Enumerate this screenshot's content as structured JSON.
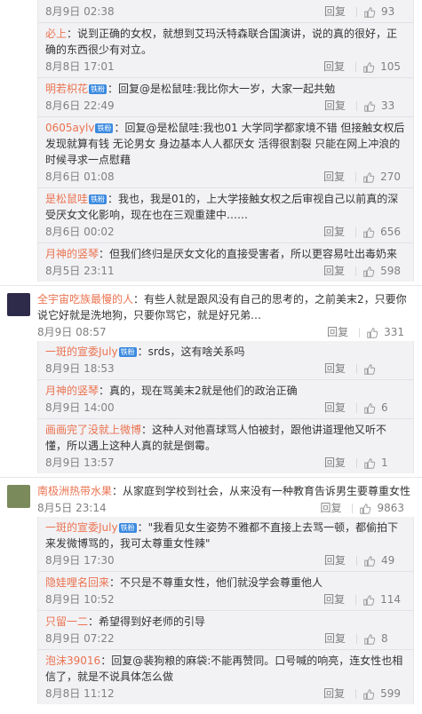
{
  "reply_labels": {
    "reply": "回复"
  },
  "block1": [
    {
      "time": "8月9日 02:38",
      "likes": "93",
      "text": ""
    },
    {
      "user": "必上",
      "sep": "：",
      "text": "说到正确的女权，就想到艾玛沃特森联合国演讲，说的真的很好，正确的东西很少有对立。",
      "time": "8月8日 17:01",
      "likes": "105"
    },
    {
      "user": "明若枳花",
      "vip": "铁粉",
      "sep": "：",
      "text": "回复@是松鼠哇:我比你大一岁，大家一起共勉",
      "time": "8月6日 22:49",
      "likes": "33"
    },
    {
      "user": "0605aylv",
      "vip": "铁粉",
      "sep": "：",
      "text": "回复@是松鼠哇:我也01 大学同学都家境不错 但接触女权后发现就算有钱 无论男女 身边基本人人都厌女 活得很割裂 只能在网上冲浪的时候寻求一点慰藉",
      "time": "8月6日 01:08",
      "likes": "270"
    },
    {
      "user": "是松鼠哇",
      "vip": "铁粉",
      "sep": "：",
      "text": "我也，我是01的，上大学接触女权之后审视自己以前真的深受厌女文化影响，现在也在三观重建中……",
      "time": "8月6日 00:02",
      "likes": "656"
    },
    {
      "user": "月神的竖琴",
      "sep": "：",
      "text": "但我们终归是厌女文化的直接受害者，所以更容易吐出毒奶来",
      "time": "8月5日 23:11",
      "likes": "598"
    }
  ],
  "comment2": {
    "user": "全宇宙吃族最慢的人",
    "sep": "：",
    "text": "有些人就是跟风没有自己的思考的，之前美末2，只要你说它好就是洗地狗，只要你骂它，就是好兄弟…",
    "time": "8月9日 08:57",
    "likes": "331"
  },
  "block2": [
    {
      "user": "一斑的宣委July",
      "vip": "铁粉",
      "sep": "：",
      "text": "srds，这有啥关系吗",
      "time": "8月9日 18:53",
      "likes": ""
    },
    {
      "user": "月神的竖琴",
      "sep": "：",
      "text": "真的，现在骂美末2就是他们的政治正确",
      "time": "8月9日 14:00",
      "likes": "6"
    },
    {
      "user": "画画完了没就上微博",
      "sep": "：",
      "text": "这种人对他喜球骂人怕被封，跟他讲道理他又听不懂，所以遇上这种人真的就是倒霉。",
      "time": "8月9日 13:57",
      "likes": "1"
    }
  ],
  "comment3": {
    "user": "南极洲热带水果",
    "sep": "：",
    "text": "从家庭到学校到社会，从来没有一种教育告诉男生要尊重女性",
    "time": "8月5日 23:14",
    "likes": "9863"
  },
  "block3": [
    {
      "user": "一斑的宣委July",
      "vip": "铁粉",
      "sep": "：",
      "text": "\"我看见女生姿势不雅都不直接上去骂一顿，都偷拍下来发微博骂的，我可太尊重女性辣\"",
      "time": "8月9日 17:30",
      "likes": "49"
    },
    {
      "user": "隐娃哩名回来",
      "sep": "：",
      "text": "不只是不尊重女性，他们就没学会尊重他人",
      "time": "8月9日 10:52",
      "likes": "114"
    },
    {
      "user": "只留一二",
      "sep": "：",
      "text": "希望得到好老师的引导",
      "time": "8月9日 07:22",
      "likes": "8"
    },
    {
      "user": "泡沫39016",
      "sep": "：",
      "text": "回复@裴狗粮的麻袋:不能再赞同。口号喊的响亮，连女性也相信了，就是不说具体怎么做",
      "time": "8月8日 11:12",
      "likes": "599"
    }
  ],
  "icons": {
    "thumb": "thumbs-up-icon"
  }
}
